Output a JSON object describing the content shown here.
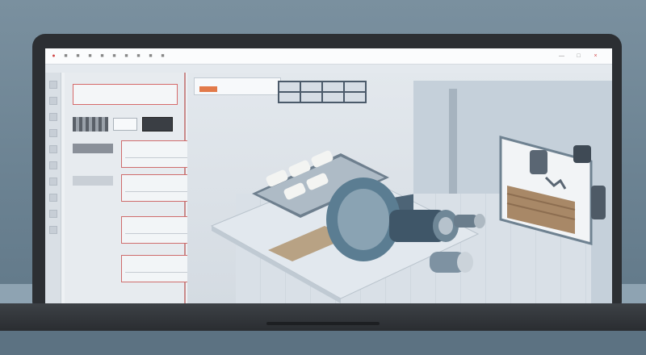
{
  "scene": {
    "kind": "laptop-screen-cad-illustration"
  },
  "topbar": {
    "buttons": [
      "btn",
      "btn",
      "btn",
      "btn",
      "btn",
      "btn",
      "btn",
      "btn",
      "btn",
      "btn"
    ],
    "right_buttons": [
      "btn",
      "btn",
      "btn",
      "btn",
      "btn"
    ]
  },
  "panel": {
    "header_label": "",
    "cards": [
      {
        "title": ""
      },
      {
        "title": ""
      },
      {
        "title": ""
      },
      {
        "title": ""
      }
    ]
  },
  "viewport": {
    "toolbar_label": "",
    "tiles": 8
  },
  "colors": {
    "accent_red": "#d56a6a",
    "accent_orange": "#e27a4a",
    "machine_blue": "#5b7d92",
    "bezel": "#2c2f33"
  },
  "icons": [
    "close-icon",
    "minimize-icon",
    "maximize-icon",
    "gear-icon"
  ]
}
